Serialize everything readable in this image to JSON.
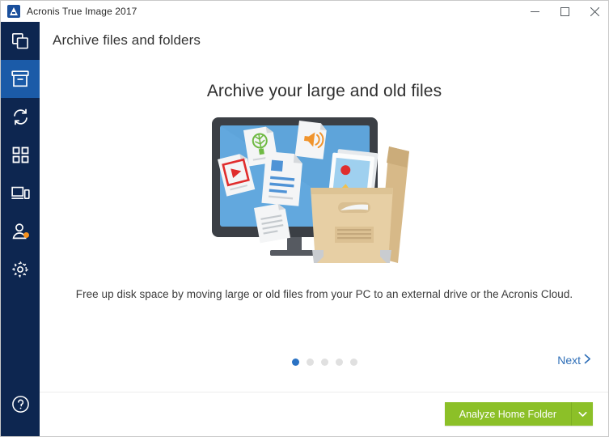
{
  "window": {
    "title": "Acronis True Image 2017",
    "logo_icon": "acronis-logo-icon",
    "controls": {
      "minimize": "minimize-icon",
      "maximize": "maximize-icon",
      "close": "close-icon"
    }
  },
  "sidebar": {
    "items": [
      {
        "name": "backup",
        "icon": "stacked-squares-icon",
        "active": false,
        "badge": false
      },
      {
        "name": "archive",
        "icon": "archive-box-icon",
        "active": true,
        "badge": false
      },
      {
        "name": "sync",
        "icon": "sync-arrows-icon",
        "active": false,
        "badge": false
      },
      {
        "name": "tools",
        "icon": "grid-squares-icon",
        "active": false,
        "badge": false
      },
      {
        "name": "dashboard",
        "icon": "devices-icon",
        "active": false,
        "badge": false
      },
      {
        "name": "account",
        "icon": "user-icon",
        "active": false,
        "badge": true
      },
      {
        "name": "settings",
        "icon": "gear-icon",
        "active": false,
        "badge": false
      }
    ],
    "help": {
      "name": "help",
      "icon": "help-circle-icon"
    }
  },
  "header": {
    "title": "Archive files and folders"
  },
  "main": {
    "headline": "Archive your large and old files",
    "description": "Free up disk space by moving large or old files from your PC to an external drive or the Acronis Cloud.",
    "illustration": "archive-box-and-monitor-illustration",
    "pagination": {
      "total": 5,
      "active_index": 0
    },
    "next_label": "Next",
    "next_icon": "chevron-right-icon"
  },
  "footer": {
    "primary_action": "Analyze Home Folder",
    "dropdown_icon": "chevron-down-icon"
  },
  "colors": {
    "sidebar": "#0d2650",
    "sidebar_active": "#1b5ba8",
    "accent_blue": "#2f6fb8",
    "action_green": "#8cc028",
    "badge_orange": "#f5911e",
    "screen_blue": "#62a8de",
    "box_tan": "#e7cfa4"
  }
}
